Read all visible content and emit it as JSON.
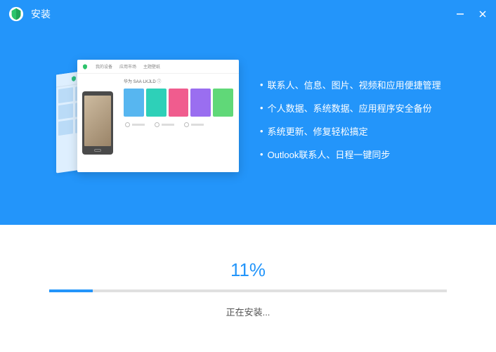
{
  "window": {
    "title": "安装"
  },
  "features": [
    "联系人、信息、图片、视频和应用便捷管理",
    "个人数据、系统数据、应用程序安全备份",
    "系统更新、修复轻松搞定",
    "Outlook联系人、日程一键同步"
  ],
  "progress": {
    "percent_label": "11%",
    "percent_value": 11,
    "status": "正在安装..."
  },
  "colors": {
    "accent": "#2395fa"
  }
}
